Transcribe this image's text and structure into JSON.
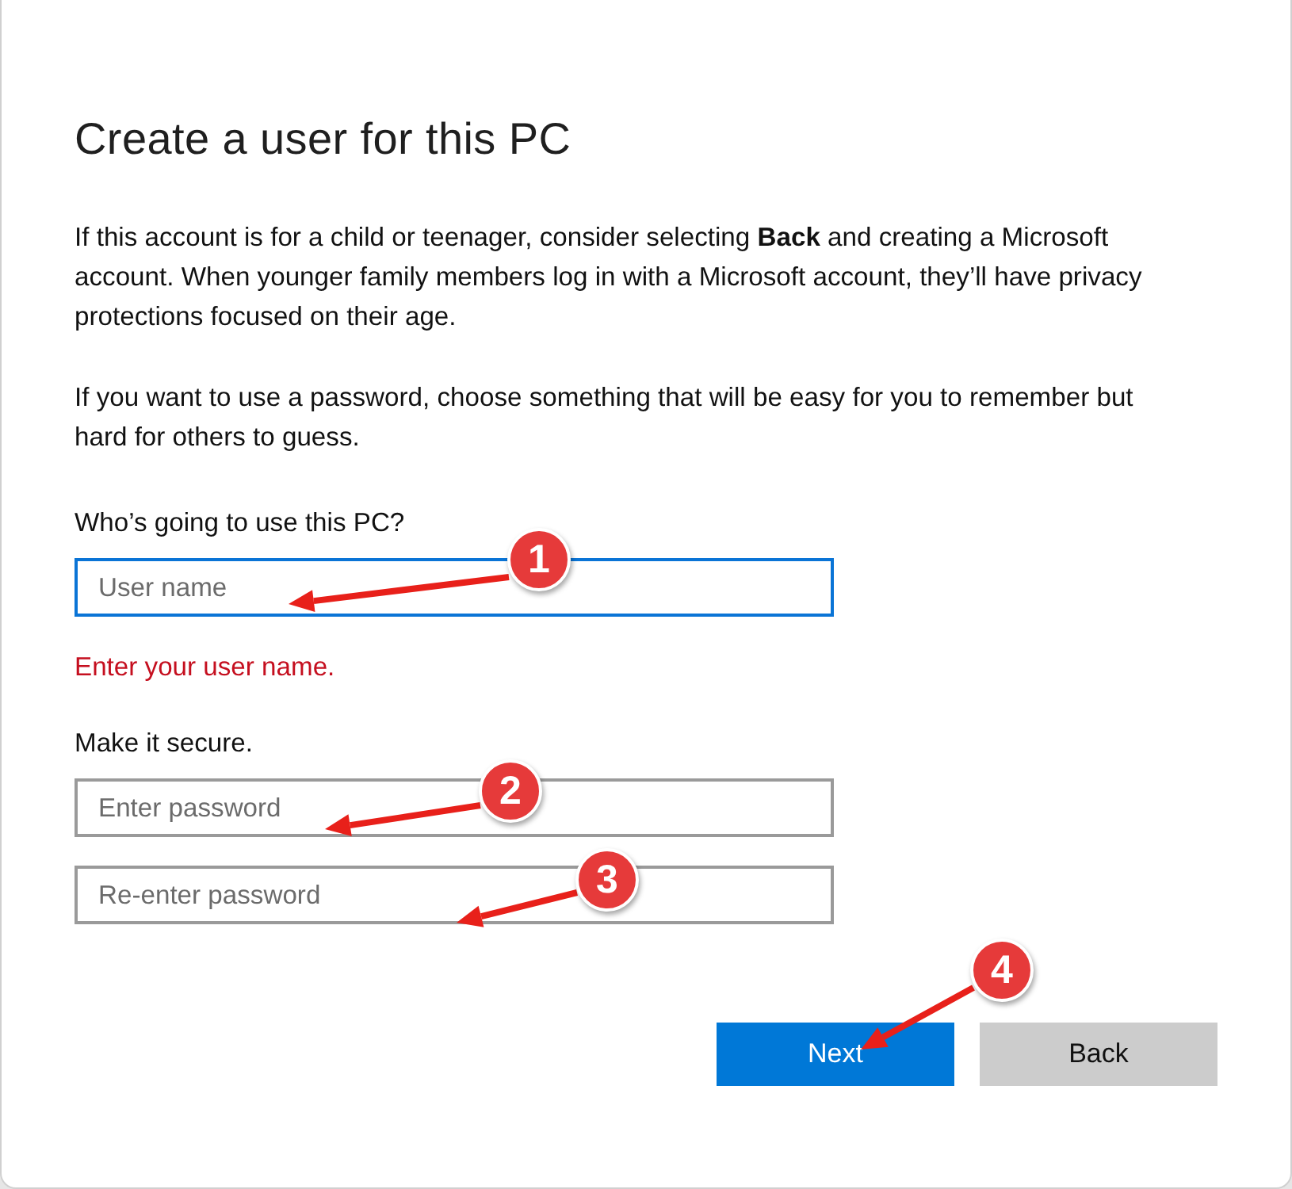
{
  "dialog": {
    "title": "Create a user for this PC",
    "paragraphs": [
      "If this account is for a child or teenager, consider selecting **Back** and creating a Microsoft account. When younger family members log in with a Microsoft account, they’ll have privacy protections focused on their age.",
      "If you want to use a password, choose something that will be easy for you to remember but hard for others to guess."
    ],
    "sections": [
      {
        "label": "Who’s going to use this PC?",
        "fields": [
          {
            "placeholder": "User name",
            "focused": true
          }
        ],
        "error": "Enter your user name."
      },
      {
        "label": "Make it secure.",
        "fields": [
          {
            "placeholder": "Enter password",
            "focused": false
          },
          {
            "placeholder": "Re-enter password",
            "focused": false
          }
        ]
      }
    ],
    "buttons": [
      {
        "label": "Next",
        "kind": "primary"
      },
      {
        "label": "Back",
        "kind": "secondary"
      }
    ]
  },
  "annotations": [
    {
      "label": "1"
    },
    {
      "label": "2"
    },
    {
      "label": "3"
    },
    {
      "label": "4"
    }
  ]
}
